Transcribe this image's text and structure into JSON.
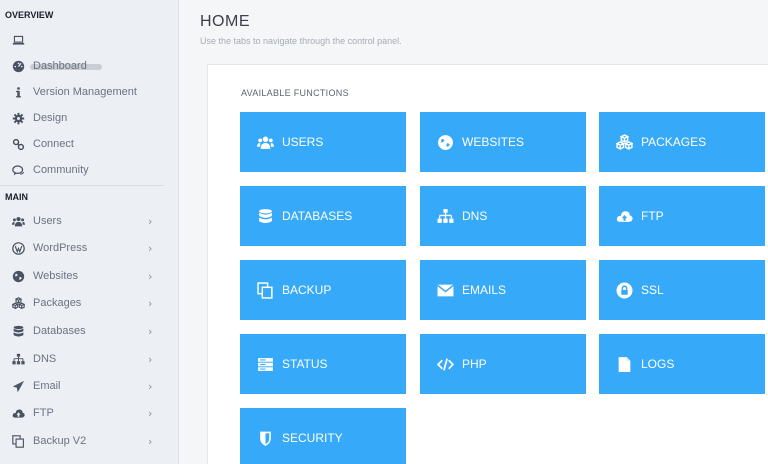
{
  "sidebar": {
    "overview_heading": "OVERVIEW",
    "main_heading": "MAIN",
    "overview_items": [
      {
        "label": "Dashboard",
        "icon": "dashboard-icon"
      },
      {
        "label": "Version Management",
        "icon": "info-icon"
      },
      {
        "label": "Design",
        "icon": "gear-icon"
      },
      {
        "label": "Connect",
        "icon": "link-icon"
      },
      {
        "label": "Community",
        "icon": "comments-icon"
      }
    ],
    "main_items": [
      {
        "label": "Users",
        "icon": "users-icon",
        "chevron": "›"
      },
      {
        "label": "WordPress",
        "icon": "wordpress-icon",
        "chevron": "›"
      },
      {
        "label": "Websites",
        "icon": "globe-icon",
        "chevron": "›"
      },
      {
        "label": "Packages",
        "icon": "cubes-icon",
        "chevron": "›"
      },
      {
        "label": "Databases",
        "icon": "database-icon",
        "chevron": "›"
      },
      {
        "label": "DNS",
        "icon": "sitemap-icon",
        "chevron": "›"
      },
      {
        "label": "Email",
        "icon": "paper-plane-icon",
        "chevron": "›"
      },
      {
        "label": "FTP",
        "icon": "cloud-upload-icon",
        "chevron": "›"
      },
      {
        "label": "Backup V2",
        "icon": "copy-icon",
        "chevron": "›"
      }
    ]
  },
  "header": {
    "title": "HOME",
    "subtitle": "Use the tabs to navigate through the control panel."
  },
  "panel": {
    "title": "AVAILABLE FUNCTIONS",
    "tiles": [
      {
        "label": "USERS",
        "icon": "users-icon"
      },
      {
        "label": "WEBSITES",
        "icon": "globe-icon"
      },
      {
        "label": "PACKAGES",
        "icon": "cubes-icon"
      },
      {
        "label": "DATABASES",
        "icon": "database-icon"
      },
      {
        "label": "DNS",
        "icon": "sitemap-icon"
      },
      {
        "label": "FTP",
        "icon": "cloud-upload-icon"
      },
      {
        "label": "BACKUP",
        "icon": "copy-icon"
      },
      {
        "label": "EMAILS",
        "icon": "envelope-icon"
      },
      {
        "label": "SSL",
        "icon": "lock-icon"
      },
      {
        "label": "STATUS",
        "icon": "server-icon"
      },
      {
        "label": "PHP",
        "icon": "code-icon"
      },
      {
        "label": "LOGS",
        "icon": "file-icon"
      },
      {
        "label": "SECURITY",
        "icon": "shield-icon"
      }
    ]
  },
  "colors": {
    "accent": "#36aaf8",
    "sidebar_bg": "#eceff4",
    "icon_dark": "#4a5160"
  }
}
